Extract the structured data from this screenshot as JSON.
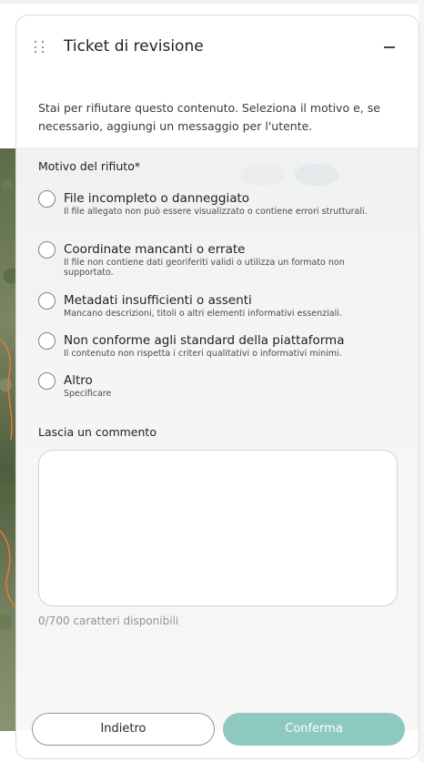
{
  "panel": {
    "title": "Ticket di revisione",
    "intro": "Stai per rifiutare questo contenuto. Seleziona il motivo e, se necessario, aggiungi un messaggio per l'utente."
  },
  "reasons": {
    "label": "Motivo del rifiuto*",
    "options": [
      {
        "title": "File incompleto o danneggiato",
        "desc": "Il file allegato non può essere visualizzato o contiene errori strutturali.",
        "selected": false
      },
      {
        "title": "Coordinate mancanti o errate",
        "desc": "Il file non contiene dati georiferiti validi o utilizza un formato non supportato.",
        "selected": false
      },
      {
        "title": "Metadati insufficienti o assenti",
        "desc": "Mancano descrizioni, titoli o altri elementi informativi essenziali.",
        "selected": false
      },
      {
        "title": "Non conforme agli standard della piattaforma",
        "desc": "Il contenuto non rispetta i criteri qualitativi o informativi minimi.",
        "selected": false
      },
      {
        "title": "Altro",
        "desc": "Specificare",
        "selected": false
      }
    ]
  },
  "comment": {
    "label": "Lascia un commento",
    "value": "",
    "counter": "0/700 caratteri disponibili"
  },
  "actions": {
    "back_label": "Indietro",
    "confirm_label": "Conferma"
  },
  "icons": {
    "drag": "drag-handle-icon",
    "minimize": "minimize-icon"
  },
  "colors": {
    "accent": "#8ec9c1",
    "border": "#d9dcdc"
  }
}
